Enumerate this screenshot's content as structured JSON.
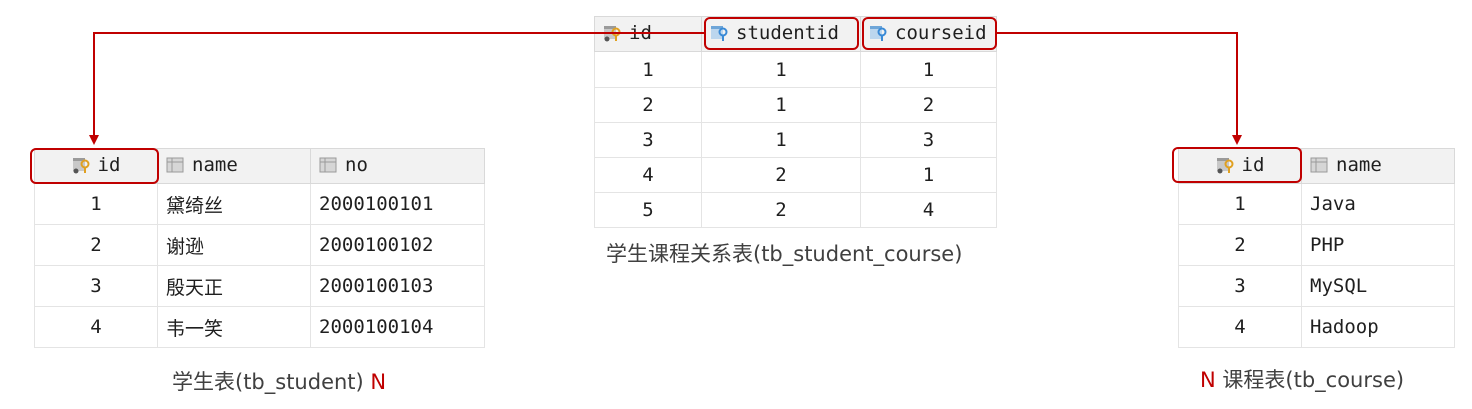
{
  "student_table": {
    "columns": [
      "id",
      "name",
      "no"
    ],
    "rows": [
      [
        "1",
        "黛绮丝",
        "2000100101"
      ],
      [
        "2",
        "谢逊",
        "2000100102"
      ],
      [
        "3",
        "殷天正",
        "2000100103"
      ],
      [
        "4",
        "韦一笑",
        "2000100104"
      ]
    ],
    "caption": "学生表(tb_student)",
    "cardinality": "N"
  },
  "relation_table": {
    "columns": [
      "id",
      "studentid",
      "courseid"
    ],
    "rows": [
      [
        "1",
        "1",
        "1"
      ],
      [
        "2",
        "1",
        "2"
      ],
      [
        "3",
        "1",
        "3"
      ],
      [
        "4",
        "2",
        "1"
      ],
      [
        "5",
        "2",
        "4"
      ]
    ],
    "caption": "学生课程关系表(tb_student_course)"
  },
  "course_table": {
    "columns": [
      "id",
      "name"
    ],
    "rows": [
      [
        "1",
        "Java"
      ],
      [
        "2",
        "PHP"
      ],
      [
        "3",
        "MySQL"
      ],
      [
        "4",
        "Hadoop"
      ]
    ],
    "caption": "课程表(tb_course)",
    "cardinality": "N"
  },
  "colors": {
    "highlight": "#c00000",
    "key_icon": "#e0a020",
    "fk_icon": "#3a8ad6"
  }
}
